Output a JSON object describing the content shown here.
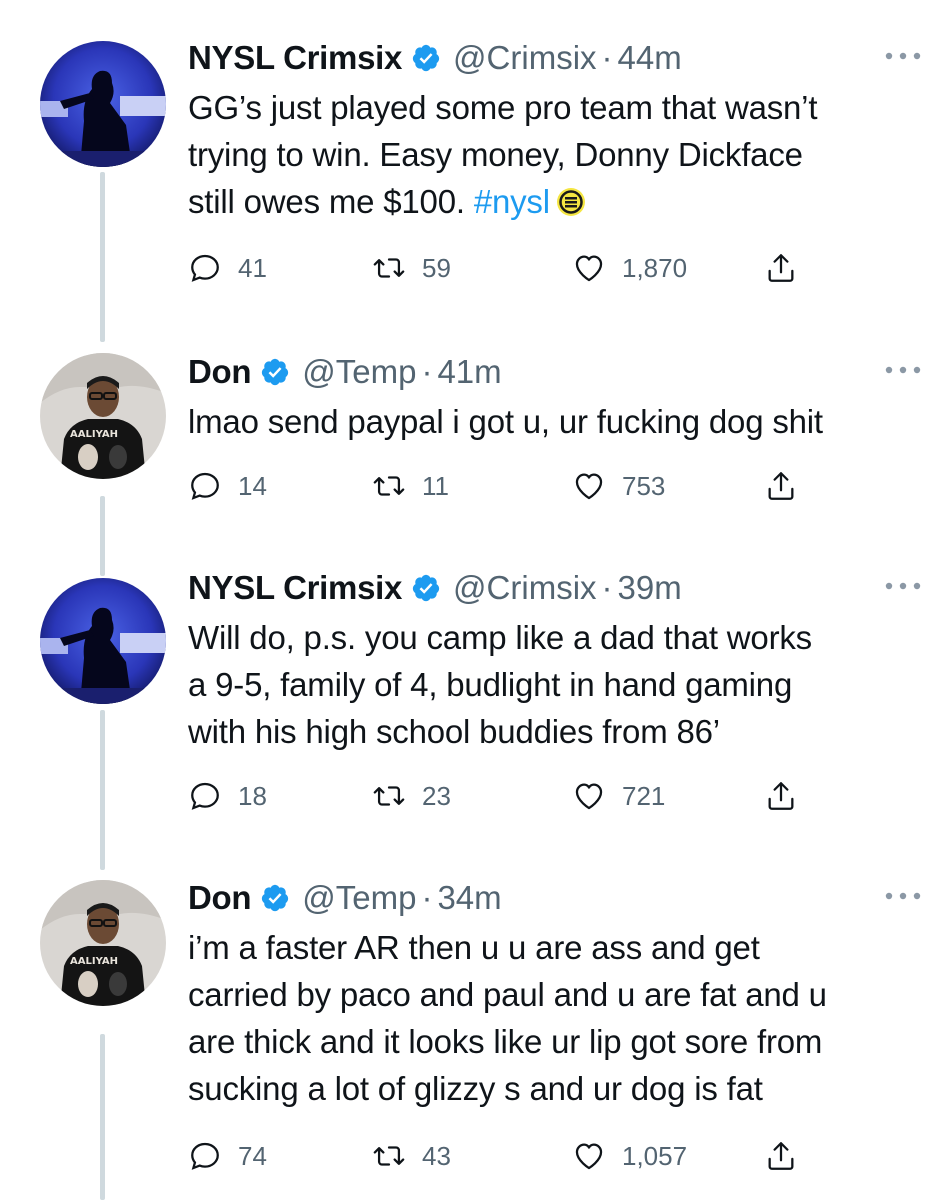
{
  "tweets": [
    {
      "name": "NYSL Crimsix",
      "handle": "@Crimsix",
      "dot": "·",
      "time": "44m",
      "lines": [
        "GG’s just played some pro team that wasn’t",
        "trying to win. Easy money, Donny Dickface",
        "still owes me $100. "
      ],
      "hashtag": "#nysl",
      "emoji_icon": "nysl-logo-emoji",
      "replies": "41",
      "retweets": "59",
      "likes": "1,870",
      "avatar": "crimsix-avatar"
    },
    {
      "name": "Don",
      "handle": "@Temp",
      "dot": "·",
      "time": "41m",
      "lines": [
        "lmao send paypal i got u, ur fucking dog shit"
      ],
      "replies": "14",
      "retweets": "11",
      "likes": "753",
      "avatar": "don-avatar"
    },
    {
      "name": "NYSL Crimsix",
      "handle": "@Crimsix",
      "dot": "·",
      "time": "39m",
      "lines": [
        "Will do, p.s. you camp like a dad that works",
        "a 9-5, family of 4, budlight in hand gaming",
        "with his high school buddies from 86’"
      ],
      "replies": "18",
      "retweets": "23",
      "likes": "721",
      "avatar": "crimsix-avatar"
    },
    {
      "name": "Don",
      "handle": "@Temp",
      "dot": "·",
      "time": "34m",
      "lines": [
        "i’m a faster AR then u u are ass and get",
        "carried by paco and paul and u are fat and u",
        "are thick and it looks like ur lip got sore from",
        "sucking a lot of glizzy s and ur dog is fat"
      ],
      "replies": "74",
      "retweets": "43",
      "likes": "1,057",
      "avatar": "don-avatar"
    }
  ],
  "colors": {
    "verified": "#1d9bf0",
    "hashtag": "#1d9bf0",
    "secondary_text": "#536471",
    "thread_line": "#cfd9de"
  },
  "icons": [
    "verified-badge-icon",
    "more-options-icon",
    "reply-icon",
    "retweet-icon",
    "like-icon",
    "share-icon"
  ]
}
